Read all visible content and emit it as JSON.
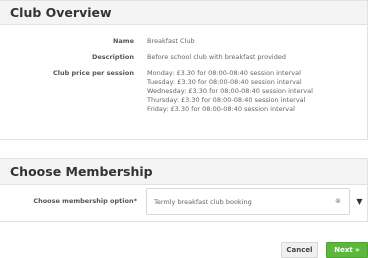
{
  "overview": {
    "title": "Club Overview",
    "name_label": "Name",
    "name_value": "Breakfast Club",
    "description_label": "Description",
    "description_value": "Before school club with breakfast provided",
    "price_label": "Club price per session",
    "prices": [
      "Monday: £3.30 for 08:00-08:40 session interval",
      "Tuesday: £3.30 for 08:00-08:40 session interval",
      "Wednesday: £3.30 for 08:00-08:40 session interval",
      "Thursday: £3.30 for 08:00-08:40 session interval",
      "Friday: £3.30 for 08:00-08:40 session interval"
    ]
  },
  "membership": {
    "title": "Choose Membership",
    "option_label": "Choose membership option*",
    "option_value": "Termly breakfast club booking",
    "clear_icon": "⊗"
  },
  "actions": {
    "cancel_label": "Cancel",
    "next_label": "Next »"
  }
}
